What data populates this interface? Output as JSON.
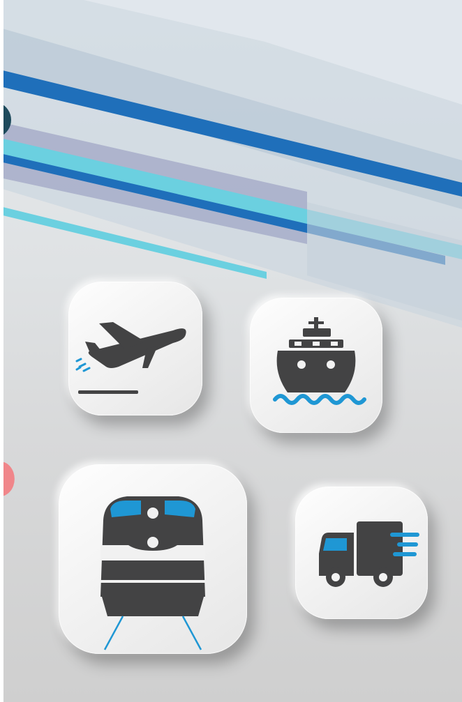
{
  "colors": {
    "icon_dark": "#434344",
    "accent_blue": "#1f97d4",
    "stripe_navy": "#1f6fba",
    "stripe_cyan": "#6bd0e0",
    "stripe_lavender": "#a7adc9",
    "stripe_pale": "#b9c8d5"
  },
  "icons": [
    "airplane-icon",
    "ship-icon",
    "train-icon",
    "truck-icon"
  ]
}
